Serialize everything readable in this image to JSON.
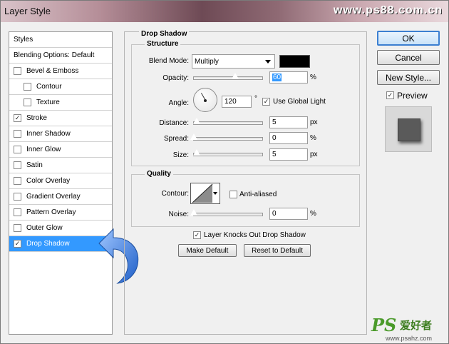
{
  "window": {
    "title": "Layer Style",
    "watermark": "www.ps88.com.cn"
  },
  "styles_panel": {
    "items": [
      {
        "label": "Styles",
        "checkbox": false,
        "checked": false
      },
      {
        "label": "Blending Options: Default",
        "checkbox": false,
        "checked": false
      },
      {
        "label": "Bevel & Emboss",
        "checkbox": true,
        "checked": false
      },
      {
        "label": "Contour",
        "checkbox": true,
        "checked": false,
        "indent": true
      },
      {
        "label": "Texture",
        "checkbox": true,
        "checked": false,
        "indent": true
      },
      {
        "label": "Stroke",
        "checkbox": true,
        "checked": true
      },
      {
        "label": "Inner Shadow",
        "checkbox": true,
        "checked": false
      },
      {
        "label": "Inner Glow",
        "checkbox": true,
        "checked": false
      },
      {
        "label": "Satin",
        "checkbox": true,
        "checked": false
      },
      {
        "label": "Color Overlay",
        "checkbox": true,
        "checked": false
      },
      {
        "label": "Gradient Overlay",
        "checkbox": true,
        "checked": false
      },
      {
        "label": "Pattern Overlay",
        "checkbox": true,
        "checked": false
      },
      {
        "label": "Outer Glow",
        "checkbox": true,
        "checked": false
      },
      {
        "label": "Drop Shadow",
        "checkbox": true,
        "checked": true,
        "selected": true
      }
    ],
    "checkmark": "✓"
  },
  "drop_shadow": {
    "title": "Drop Shadow",
    "structure": {
      "title": "Structure",
      "blend_mode_label": "Blend Mode:",
      "blend_mode_value": "Multiply",
      "shadow_color": "#000000",
      "opacity_label": "Opacity:",
      "opacity_value": "60",
      "opacity_level": 0.6,
      "percent": "%",
      "angle_label": "Angle:",
      "angle_value": "120",
      "degree": "°",
      "use_global_light_label": "Use Global Light",
      "use_global_light_checked": true,
      "distance_label": "Distance:",
      "distance_value": "5",
      "spread_label": "Spread:",
      "spread_value": "0",
      "size_label": "Size:",
      "size_value": "5",
      "px": "px"
    },
    "quality": {
      "title": "Quality",
      "contour_label": "Contour:",
      "anti_aliased_label": "Anti-aliased",
      "anti_aliased_checked": false,
      "noise_label": "Noise:",
      "noise_value": "0",
      "percent": "%"
    },
    "layer_knocks_out_label": "Layer Knocks Out Drop Shadow",
    "layer_knocks_out_checked": true,
    "make_default_label": "Make Default",
    "reset_default_label": "Reset to Default"
  },
  "actions": {
    "ok_label": "OK",
    "cancel_label": "Cancel",
    "new_style_label": "New Style...",
    "preview_label": "Preview",
    "preview_checked": true
  },
  "branding": {
    "logo_text": "PS",
    "logo_cjk": "爱好者",
    "url": "www.psahz.com"
  },
  "icons": [
    "checkbox-check-icon",
    "dropdown-arrow-icon",
    "angle-dial-icon",
    "contour-curve-icon",
    "curved-arrow-icon"
  ]
}
